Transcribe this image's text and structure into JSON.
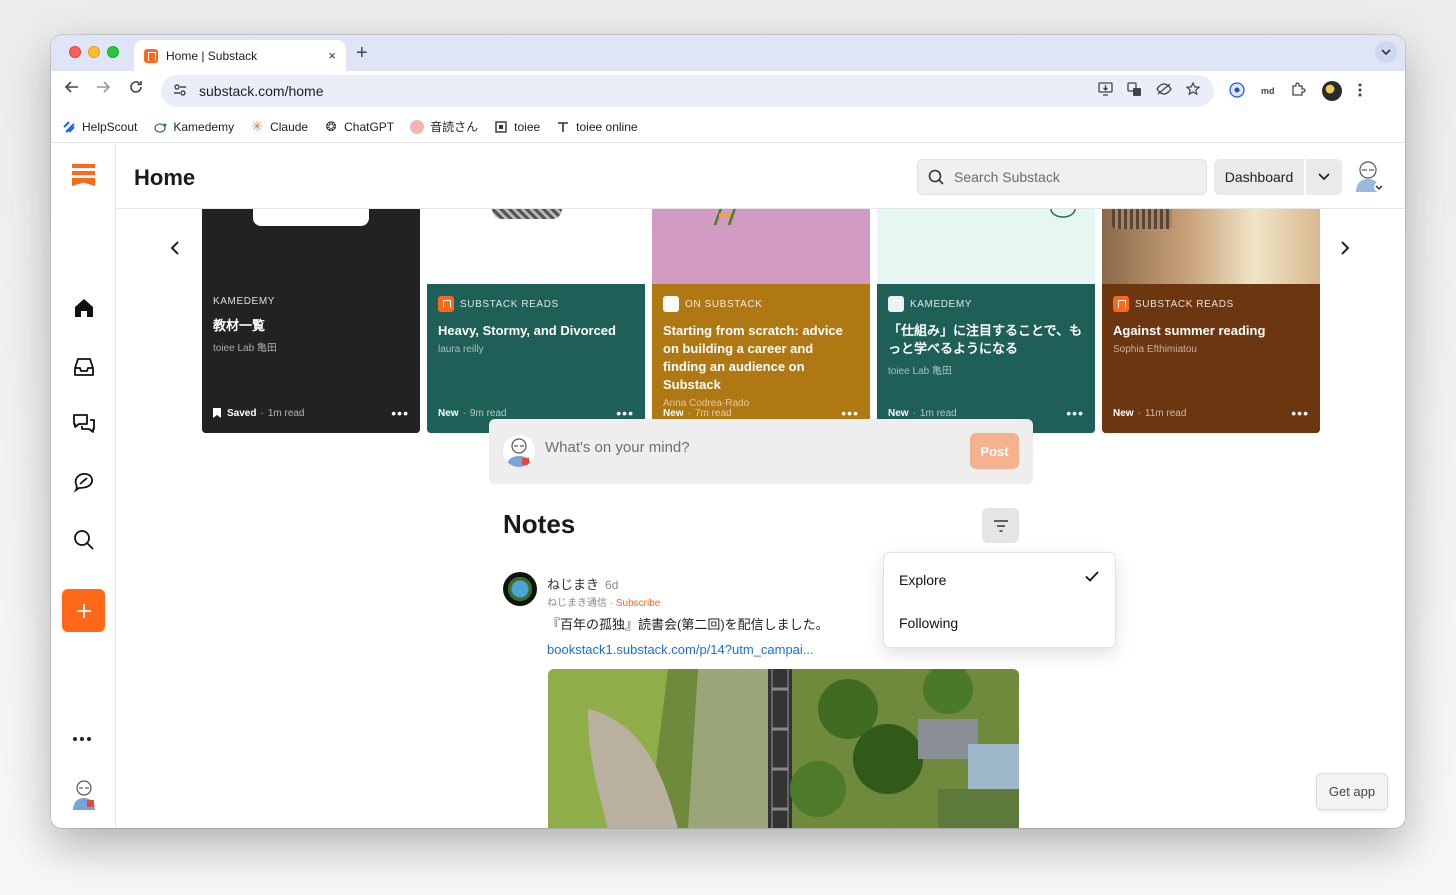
{
  "browser": {
    "tab_title": "Home | Substack",
    "tab_close": "×",
    "new_tab": "+",
    "url": "substack.com/home",
    "bookmarks": [
      {
        "label": "HelpScout",
        "icon": "helpscout-icon"
      },
      {
        "label": "Kamedemy",
        "icon": "kamedemy-icon"
      },
      {
        "label": "Claude",
        "icon": "claude-icon"
      },
      {
        "label": "ChatGPT",
        "icon": "chatgpt-icon"
      },
      {
        "label": "音読さん",
        "icon": "ondoku-icon"
      },
      {
        "label": "toiee",
        "icon": "toiee-icon"
      },
      {
        "label": "toiee online",
        "icon": "toiee-online-icon"
      }
    ]
  },
  "header": {
    "title": "Home",
    "search_placeholder": "Search Substack",
    "dashboard_label": "Dashboard"
  },
  "cards": [
    {
      "publication": "KAMEDEMY",
      "title": "教材一覧",
      "author": "toiee Lab 亀田",
      "status": "Saved",
      "read_time": "1m read",
      "bg": "#222222",
      "icon": "kamedemy-icon"
    },
    {
      "publication": "SUBSTACK READS",
      "title": "Heavy, Stormy, and Divorced",
      "author": "laura reilly",
      "status": "New",
      "read_time": "9m read",
      "bg": "#1e5f57",
      "icon": "substack-reads-icon"
    },
    {
      "publication": "ON SUBSTACK",
      "title": "Starting from scratch: advice on building a career and finding an audience on Substack",
      "author": "Anna Codrea-Rado",
      "status": "New",
      "read_time": "7m read",
      "bg": "#b07812",
      "icon": "on-substack-icon"
    },
    {
      "publication": "KAMEDEMY",
      "title": "「仕組み」に注目することで、もっと学べるようになる",
      "author": "toiee Lab 亀田",
      "status": "New",
      "read_time": "1m read",
      "bg": "#1e5f57",
      "icon": "kamedemy-icon"
    },
    {
      "publication": "SUBSTACK READS",
      "title": "Against summer reading",
      "author": "Sophia Efthimiatou",
      "status": "New",
      "read_time": "11m read",
      "bg": "#6b3610",
      "icon": "substack-reads-icon"
    }
  ],
  "composer": {
    "placeholder": "What's on your mind?",
    "post_label": "Post"
  },
  "notes": {
    "heading": "Notes",
    "filter_options": [
      {
        "label": "Explore",
        "selected": true
      },
      {
        "label": "Following",
        "selected": false
      }
    ],
    "items": [
      {
        "author": "ねじまき",
        "time": "6d",
        "publication": "ねじまき通信",
        "subscribe_label": "Subscribe",
        "text": "『百年の孤独』読書会(第二回)を配信しました。",
        "link": "bookstack1.substack.com/p/14?utm_campai..."
      }
    ]
  },
  "get_app_label": "Get app",
  "colors": {
    "brand": "#ff6719",
    "post_button": "#f5b28f",
    "link": "#1a6ed8"
  }
}
